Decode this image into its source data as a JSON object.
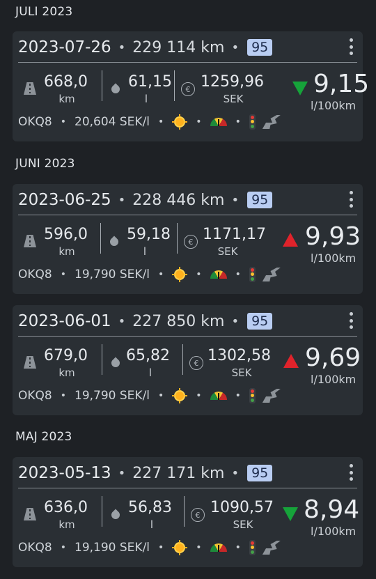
{
  "months": [
    "JULI 2023",
    "JUNI 2023",
    "MAJ 2023"
  ],
  "entries": [
    {
      "date": "2023-07-26",
      "odometer": "229 114 km",
      "fuel_type": "95",
      "distance": "668,0",
      "distance_unit": "km",
      "volume": "61,15",
      "volume_unit": "l",
      "cost": "1259,96",
      "cost_unit": "SEK",
      "consumption": "9,15",
      "consumption_unit": "l/100km",
      "trend": "down",
      "station": "OKQ8",
      "price": "20,604 SEK/l"
    },
    {
      "date": "2023-06-25",
      "odometer": "228 446 km",
      "fuel_type": "95",
      "distance": "596,0",
      "distance_unit": "km",
      "volume": "59,18",
      "volume_unit": "l",
      "cost": "1171,17",
      "cost_unit": "SEK",
      "consumption": "9,93",
      "consumption_unit": "l/100km",
      "trend": "up",
      "station": "OKQ8",
      "price": "19,790 SEK/l"
    },
    {
      "date": "2023-06-01",
      "odometer": "227 850 km",
      "fuel_type": "95",
      "distance": "679,0",
      "distance_unit": "km",
      "volume": "65,82",
      "volume_unit": "l",
      "cost": "1302,58",
      "cost_unit": "SEK",
      "consumption": "9,69",
      "consumption_unit": "l/100km",
      "trend": "up",
      "station": "OKQ8",
      "price": "19,790 SEK/l"
    },
    {
      "date": "2023-05-13",
      "odometer": "227 171 km",
      "fuel_type": "95",
      "distance": "636,0",
      "distance_unit": "km",
      "volume": "56,83",
      "volume_unit": "l",
      "cost": "1090,57",
      "cost_unit": "SEK",
      "consumption": "8,94",
      "consumption_unit": "l/100km",
      "trend": "down",
      "station": "OKQ8",
      "price": "19,190 SEK/l"
    }
  ],
  "icons": [
    "road-icon",
    "fuel-drop-icon",
    "euro-icon",
    "sun-icon",
    "gauge-icon",
    "traffic-light-icon",
    "curvy-road-icon",
    "more-vert-icon"
  ],
  "colors": {
    "trend_down": "#16a33a",
    "trend_up": "#e0232b",
    "badge": "#b9cdf2"
  }
}
